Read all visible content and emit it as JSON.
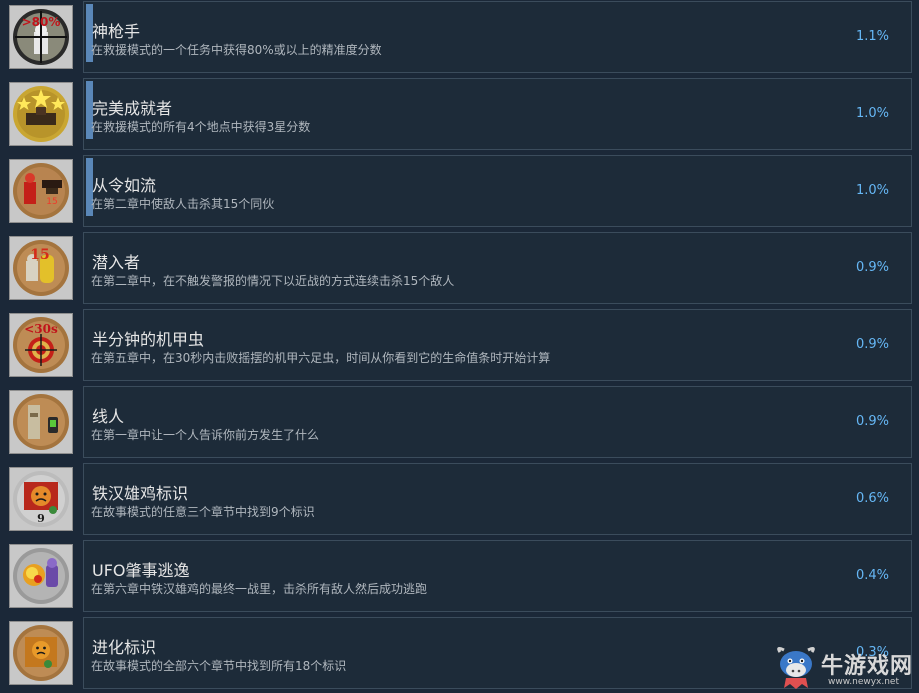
{
  "achievements": [
    {
      "title": "神枪手",
      "description": "在救援模式的一个任务中获得80%或以上的精准度分数",
      "percent": "1.1%",
      "unlock_fraction": 0.011,
      "icon": "sniper-scope-icon",
      "icon_text": ">80%"
    },
    {
      "title": "完美成就者",
      "description": "在救援模式的所有4个地点中获得3星分数",
      "percent": "1.0%",
      "unlock_fraction": 0.01,
      "icon": "three-stars-icon"
    },
    {
      "title": "从令如流",
      "description": "在第二章中使敌人击杀其15个同伙",
      "percent": "1.0%",
      "unlock_fraction": 0.01,
      "icon": "enemies-icon",
      "icon_text": "15"
    },
    {
      "title": "潜入者",
      "description": "在第二章中，在不触发警报的情况下以近战的方式连续击杀15个敌人",
      "percent": "0.9%",
      "unlock_fraction": 0.009,
      "icon": "infiltrator-icon",
      "icon_text": "15"
    },
    {
      "title": "半分钟的机甲虫",
      "description": "在第五章中，在30秒内击败摇摆的机甲六足虫，时间从你看到它的生命值条时开始计算",
      "percent": "0.9%",
      "unlock_fraction": 0.009,
      "icon": "target-timer-icon",
      "icon_text": "<30s"
    },
    {
      "title": "线人",
      "description": "在第一章中让一个人告诉你前方发生了什么",
      "percent": "0.9%",
      "unlock_fraction": 0.009,
      "icon": "informant-icon"
    },
    {
      "title": "铁汉雄鸡标识",
      "description": "在故事模式的任意三个章节中找到9个标识",
      "percent": "0.6%",
      "unlock_fraction": 0.006,
      "icon": "sad-face-sign-icon",
      "icon_text": "9"
    },
    {
      "title": "UFO肇事逃逸",
      "description": "在第六章中铁汉雄鸡的最终一战里，击杀所有敌人然后成功逃跑",
      "percent": "0.4%",
      "unlock_fraction": 0.004,
      "icon": "explosion-icon"
    },
    {
      "title": "进化标识",
      "description": "在故事模式的全部六个章节中找到所有18个标识",
      "percent": "0.3%",
      "unlock_fraction": 0.003,
      "icon": "sad-face-badge-icon"
    }
  ],
  "watermark": {
    "name": "牛游戏网",
    "url": "www.newyx.net",
    "icon": "cow-logo-icon"
  },
  "colors": {
    "background": "#1b2838",
    "percent": "#66b7f5",
    "progress": "#5a87b8"
  }
}
